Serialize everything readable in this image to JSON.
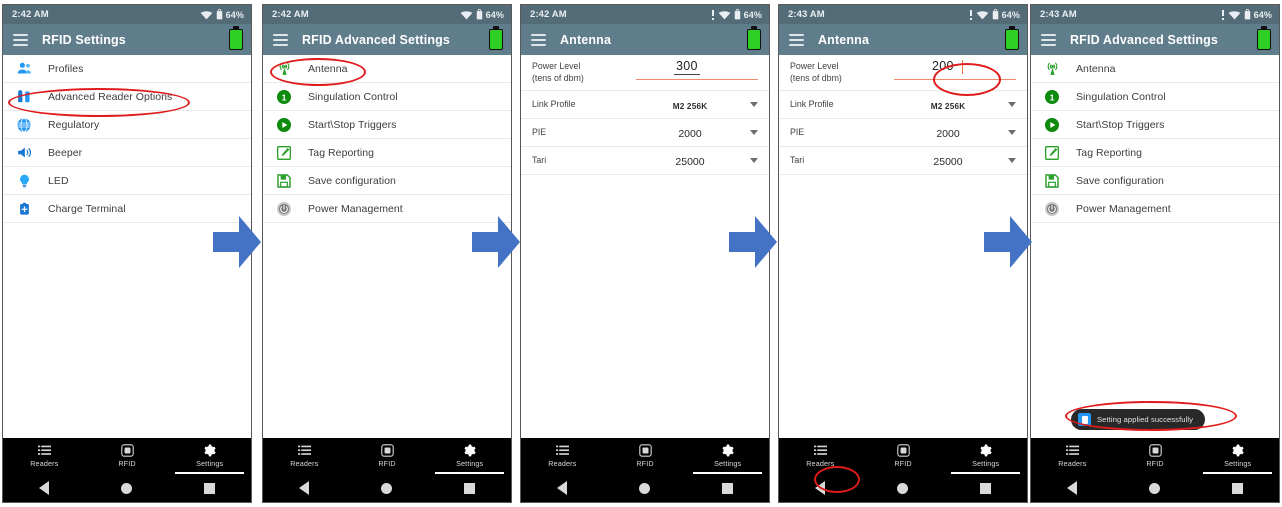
{
  "panels": [
    {
      "id": "rfid-settings",
      "statusbar": {
        "time": "2:42 AM",
        "battery_pct": "64%",
        "has_alert_icon": false
      },
      "appbar": {
        "title": "RFID Settings"
      },
      "menu": [
        {
          "label": "Profiles",
          "icon": "person-icon",
          "color": "#2196f3"
        },
        {
          "label": "Advanced Reader Options",
          "icon": "sliders-icon",
          "color": "#2196f3"
        },
        {
          "label": "Regulatory",
          "icon": "globe-icon",
          "color": "#2196f3"
        },
        {
          "label": "Beeper",
          "icon": "speaker-icon",
          "color": "#2196f3"
        },
        {
          "label": "LED",
          "icon": "lightbulb-icon",
          "color": "#2196f3"
        },
        {
          "label": "Charge Terminal",
          "icon": "battery-plus-icon",
          "color": "#2196f3"
        }
      ],
      "tabs": [
        {
          "label": "Readers",
          "icon": "list-icon",
          "active": false
        },
        {
          "label": "RFID",
          "icon": "rfid-tag-icon",
          "active": false
        },
        {
          "label": "Settings",
          "icon": "gear-icon",
          "active": true
        }
      ],
      "nav": {
        "back": "back-triangle-icon",
        "home": "home-circle-icon",
        "recents": "recents-square-icon"
      }
    },
    {
      "id": "rfid-advanced-settings",
      "statusbar": {
        "time": "2:42 AM",
        "battery_pct": "64%",
        "has_alert_icon": false
      },
      "appbar": {
        "title": "RFID Advanced Settings"
      },
      "menu": [
        {
          "label": "Antenna",
          "icon": "antenna-icon",
          "color": "#2aa02a"
        },
        {
          "label": "Singulation Control",
          "icon": "number-one-icon",
          "color": "#0e8a0e"
        },
        {
          "label": "Start\\Stop Triggers",
          "icon": "play-icon",
          "color": "#0e8a0e"
        },
        {
          "label": "Tag Reporting",
          "icon": "edit-square-icon",
          "color": "#2aa02a"
        },
        {
          "label": "Save configuration",
          "icon": "save-floppy-icon",
          "color": "#2aa02a"
        },
        {
          "label": "Power Management",
          "icon": "power-management-icon",
          "color": "#777777"
        }
      ],
      "tabs": [
        {
          "label": "Readers",
          "icon": "list-icon",
          "active": false
        },
        {
          "label": "RFID",
          "icon": "rfid-tag-icon",
          "active": false
        },
        {
          "label": "Settings",
          "icon": "gear-icon",
          "active": true
        }
      ],
      "nav": {
        "back": "back-triangle-icon",
        "home": "home-circle-icon",
        "recents": "recents-square-icon"
      }
    },
    {
      "id": "antenna-before",
      "statusbar": {
        "time": "2:42 AM",
        "battery_pct": "64%",
        "has_alert_icon": true
      },
      "appbar": {
        "title": "Antenna"
      },
      "form": {
        "power_level": {
          "label_line1": "Power Level",
          "label_line2": "(tens of dbm)",
          "value": "300",
          "editing": false
        },
        "rows": [
          {
            "label": "Link Profile",
            "value": "M2 256K",
            "small": true
          },
          {
            "label": "PIE",
            "value": "2000",
            "small": false
          },
          {
            "label": "Tari",
            "value": "25000",
            "small": false
          }
        ]
      },
      "tabs": [
        {
          "label": "Readers",
          "icon": "list-icon",
          "active": false
        },
        {
          "label": "RFID",
          "icon": "rfid-tag-icon",
          "active": false
        },
        {
          "label": "Settings",
          "icon": "gear-icon",
          "active": true
        }
      ],
      "nav": {
        "back": "back-triangle-icon",
        "home": "home-circle-icon",
        "recents": "recents-square-icon"
      }
    },
    {
      "id": "antenna-after",
      "statusbar": {
        "time": "2:43 AM",
        "battery_pct": "64%",
        "has_alert_icon": true
      },
      "appbar": {
        "title": "Antenna"
      },
      "form": {
        "power_level": {
          "label_line1": "Power Level",
          "label_line2": "(tens of dbm)",
          "value": "200",
          "editing": true
        },
        "rows": [
          {
            "label": "Link Profile",
            "value": "M2 256K",
            "small": true
          },
          {
            "label": "PIE",
            "value": "2000",
            "small": false
          },
          {
            "label": "Tari",
            "value": "25000",
            "small": false
          }
        ]
      },
      "tabs": [
        {
          "label": "Readers",
          "icon": "list-icon",
          "active": false
        },
        {
          "label": "RFID",
          "icon": "rfid-tag-icon",
          "active": false
        },
        {
          "label": "Settings",
          "icon": "gear-icon",
          "active": true
        }
      ],
      "nav": {
        "back": "back-triangle-icon",
        "home": "home-circle-icon",
        "recents": "recents-square-icon"
      }
    },
    {
      "id": "rfid-advanced-settings-confirm",
      "statusbar": {
        "time": "2:43 AM",
        "battery_pct": "64%",
        "has_alert_icon": true
      },
      "appbar": {
        "title": "RFID Advanced Settings"
      },
      "menu": [
        {
          "label": "Antenna",
          "icon": "antenna-icon",
          "color": "#2aa02a"
        },
        {
          "label": "Singulation Control",
          "icon": "number-one-icon",
          "color": "#0e8a0e"
        },
        {
          "label": "Start\\Stop Triggers",
          "icon": "play-icon",
          "color": "#0e8a0e"
        },
        {
          "label": "Tag Reporting",
          "icon": "edit-square-icon",
          "color": "#2aa02a"
        },
        {
          "label": "Save configuration",
          "icon": "save-floppy-icon",
          "color": "#2aa02a"
        },
        {
          "label": "Power Management",
          "icon": "power-management-icon",
          "color": "#777777"
        }
      ],
      "toast": {
        "text": "Setting applied successfully",
        "icon": "app-icon"
      },
      "tabs": [
        {
          "label": "Readers",
          "icon": "list-icon",
          "active": false
        },
        {
          "label": "RFID",
          "icon": "rfid-tag-icon",
          "active": false
        },
        {
          "label": "Settings",
          "icon": "gear-icon",
          "active": true
        }
      ],
      "nav": {
        "back": "back-triangle-icon",
        "home": "home-circle-icon",
        "recents": "recents-square-icon"
      }
    }
  ],
  "annotations": {
    "highlight_color": "#e01b1b",
    "arrow_color": "#4472c4",
    "arrow_count": 4
  }
}
